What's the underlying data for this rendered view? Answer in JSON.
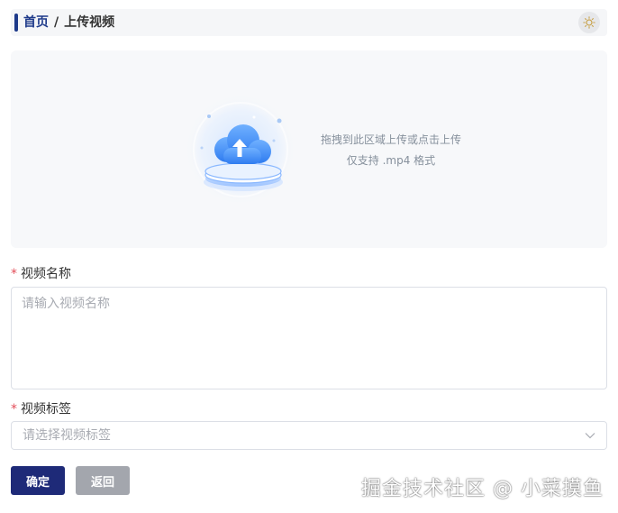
{
  "breadcrumb": {
    "home": "首页",
    "separator": "/",
    "current": "上传视频"
  },
  "header": {
    "theme_toggle_icon": "sun-icon"
  },
  "upload": {
    "icon": "cloud-upload-icon",
    "line1": "拖拽到此区域上传或点击上传",
    "line2": "仅支持 .mp4 格式"
  },
  "form": {
    "required_mark": "*",
    "name_label": "视频名称",
    "name_placeholder": "请输入视频名称",
    "tag_label": "视频标签",
    "tag_placeholder": "请选择视频标签"
  },
  "buttons": {
    "confirm": "确定",
    "back": "返回"
  },
  "watermark": "掘金技术社区 @ 小菜摸鱼",
  "colors": {
    "accent": "#1e3a8a",
    "confirm_button": "#1e2a78",
    "back_button": "#a3a6ad",
    "required": "#e34d59"
  }
}
